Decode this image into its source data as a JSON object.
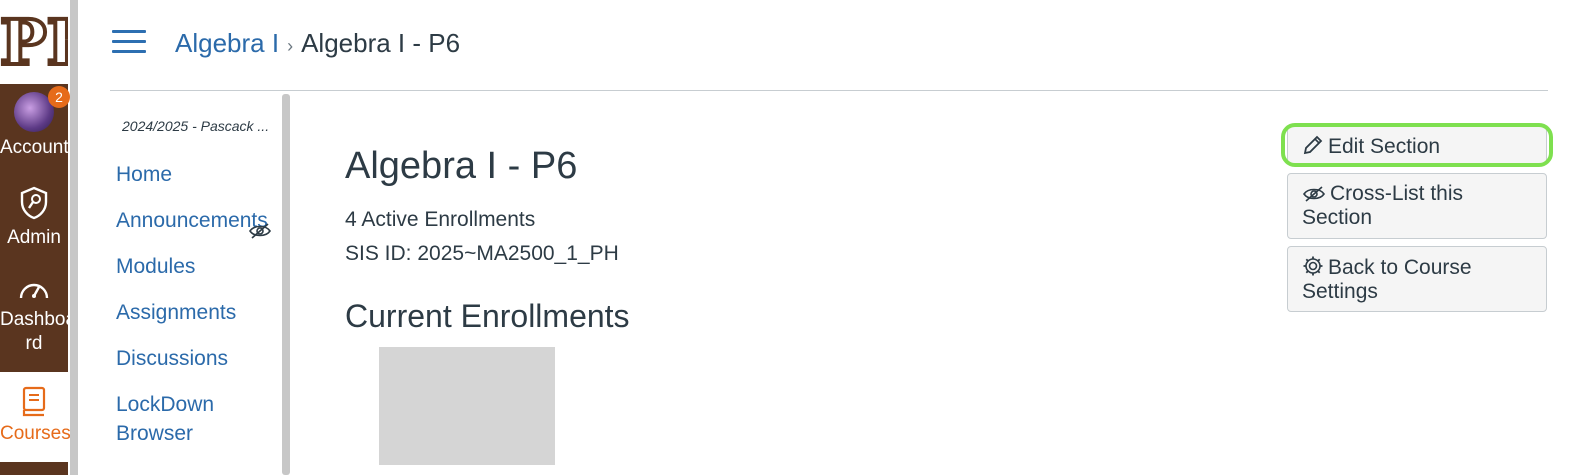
{
  "global_nav": {
    "logo_text": "PH",
    "account": {
      "label": "Account",
      "badge": "2"
    },
    "admin": {
      "label": "Admin"
    },
    "dashboard": {
      "label_1": "Dashboa",
      "label_2": "rd"
    },
    "courses": {
      "label": "Courses"
    },
    "colors": {
      "background": "#5a351f",
      "active": "#e66b1a"
    }
  },
  "header": {
    "breadcrumb_course": "Algebra I",
    "breadcrumb_current": "Algebra I - P6"
  },
  "course_nav": {
    "term": "2024/2025 - Pascack ...",
    "items": [
      {
        "label": "Home"
      },
      {
        "label": "Announcements"
      },
      {
        "label": "Modules"
      },
      {
        "label": "Assignments"
      },
      {
        "label": "Discussions"
      },
      {
        "label": "LockDown Browser"
      }
    ]
  },
  "main": {
    "title": "Algebra I - P6",
    "enrollments": "4 Active Enrollments",
    "sis_id": "SIS ID: 2025~MA2500_1_PH",
    "current_enrollments_heading": "Current Enrollments"
  },
  "side_buttons": {
    "edit_section": "Edit Section",
    "cross_list": "Cross-List this Section",
    "back_to_settings": "Back to Course Settings"
  },
  "colors": {
    "link": "#2b6aaa",
    "focus": "#7ee04f",
    "text": "#2d3b45"
  }
}
